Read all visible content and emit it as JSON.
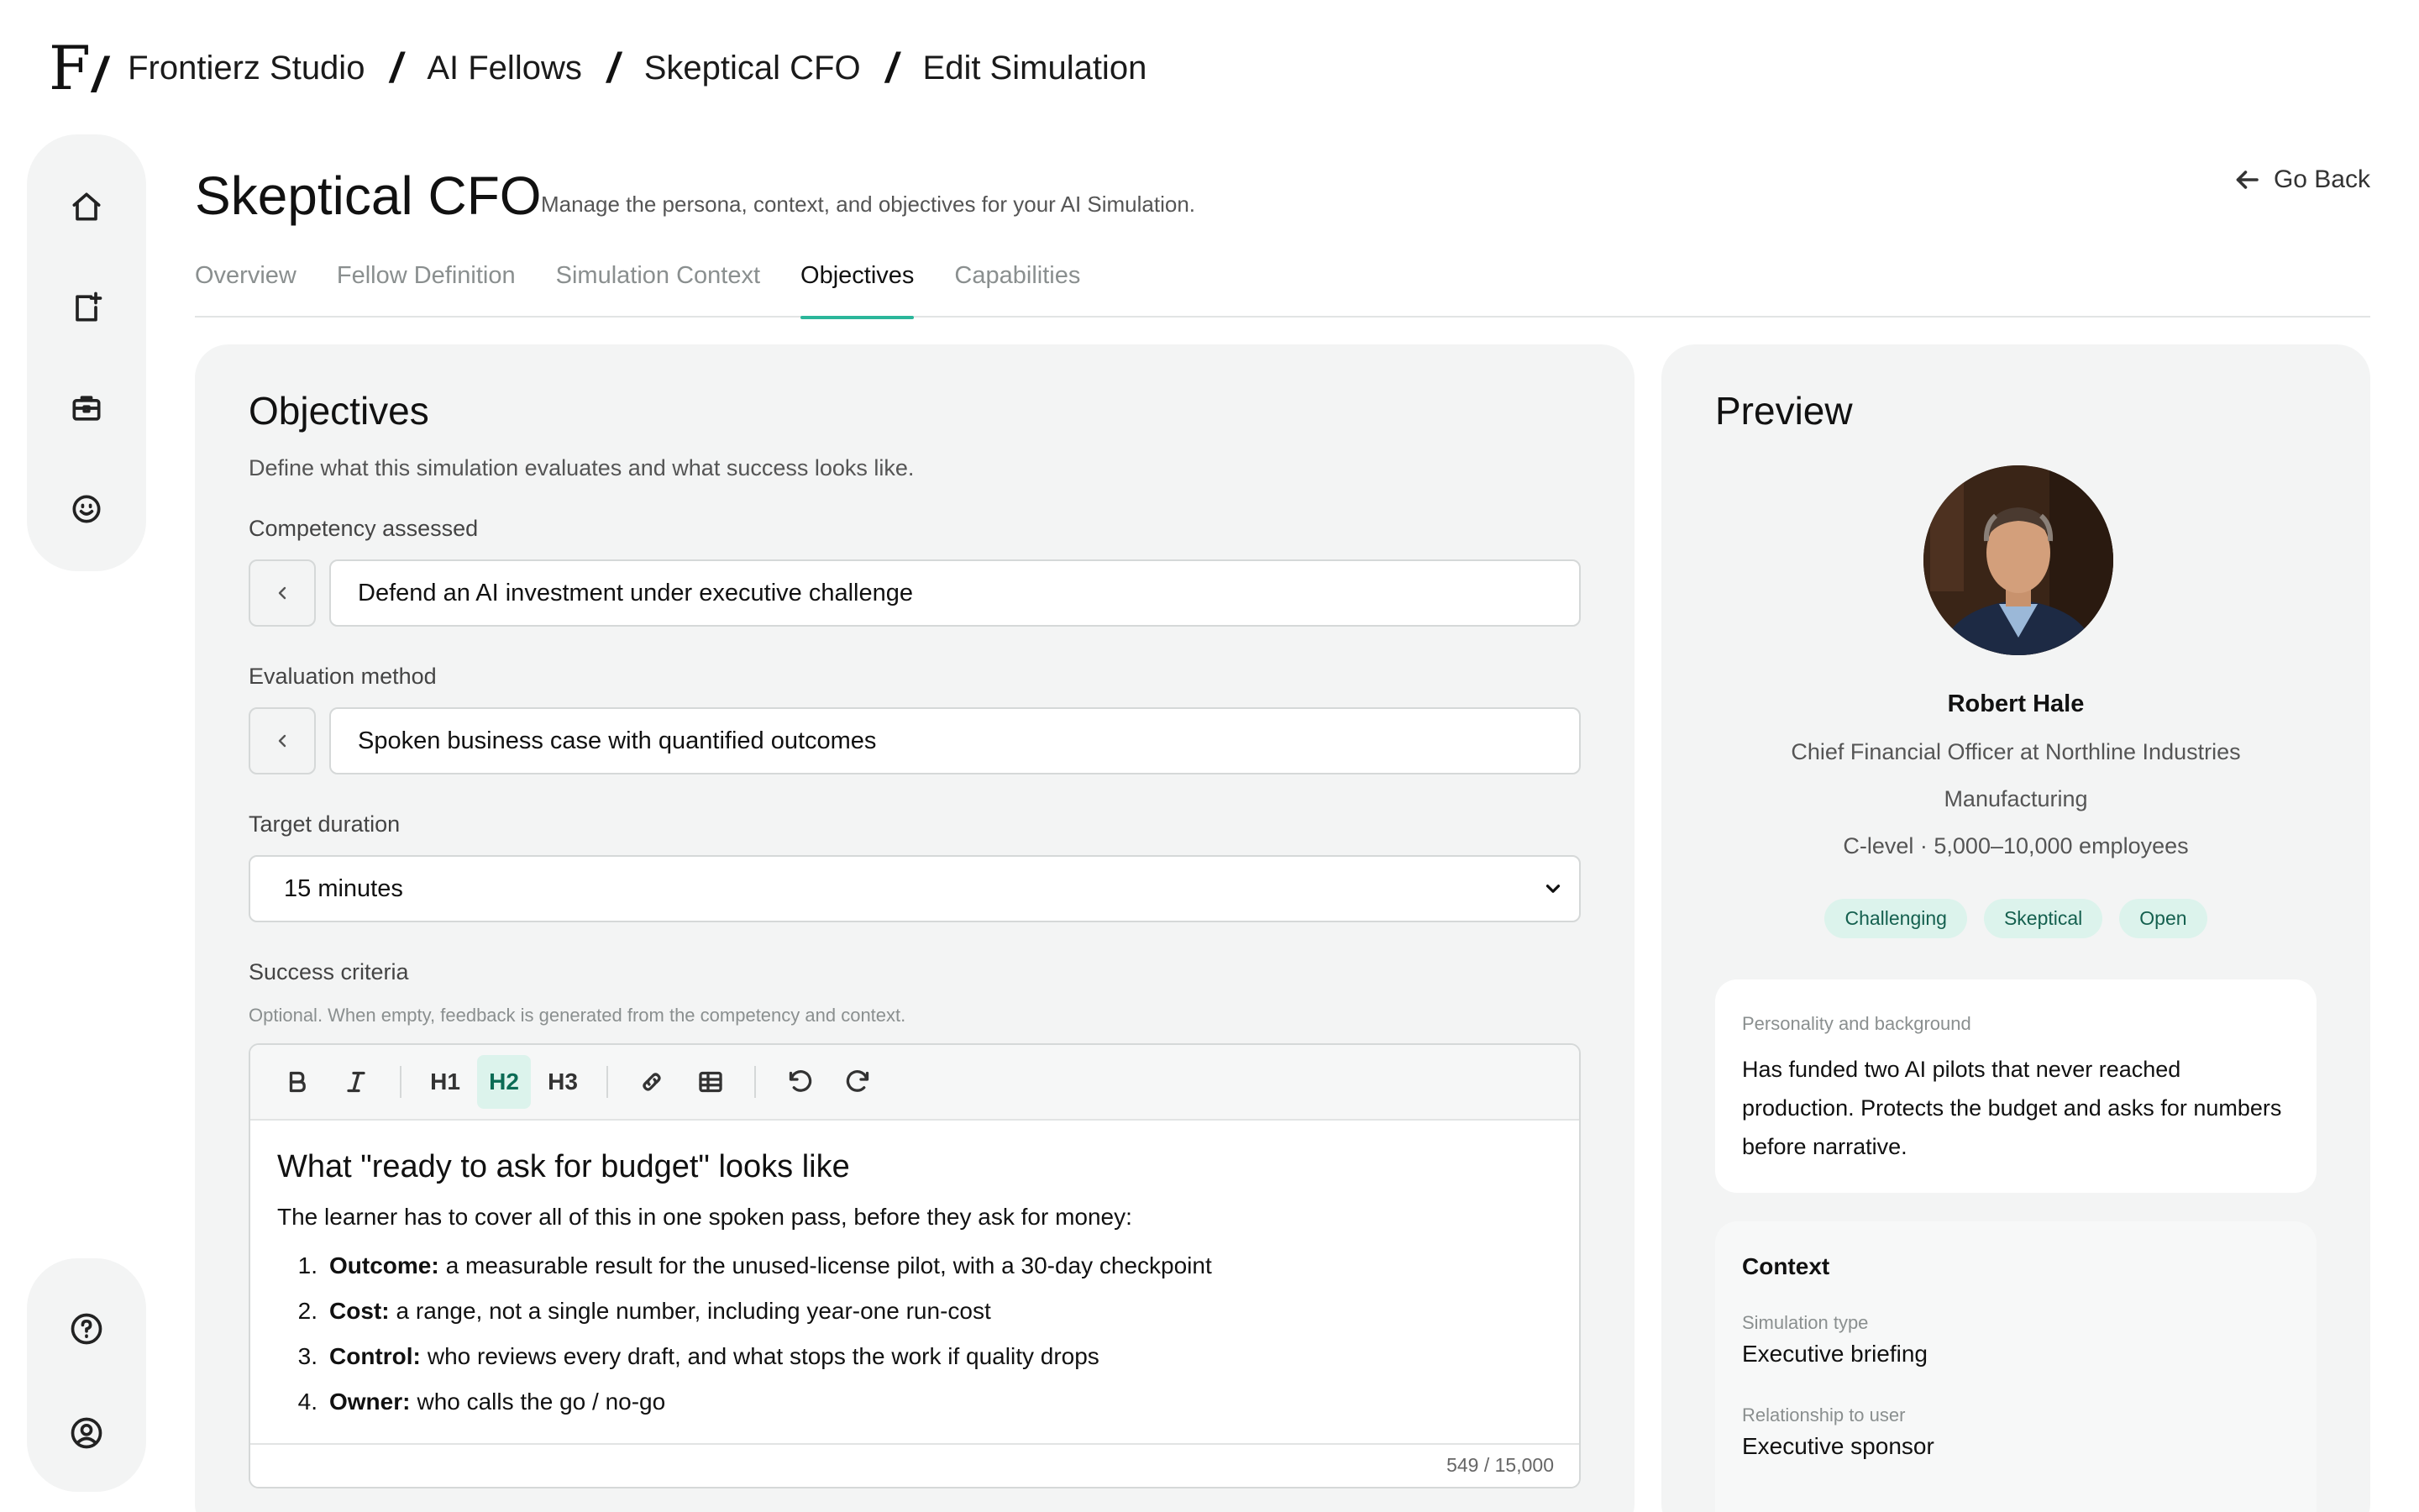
{
  "breadcrumb": {
    "logo": "F",
    "items": [
      "Frontierz Studio",
      "AI Fellows",
      "Skeptical CFO",
      "Edit Simulation"
    ]
  },
  "page": {
    "title": "Skeptical CFO",
    "subtitle": "Manage the persona, context, and objectives for your AI Simulation.",
    "go_back": "Go Back"
  },
  "tabs": [
    "Overview",
    "Fellow Definition",
    "Simulation Context",
    "Objectives",
    "Capabilities"
  ],
  "active_tab": "Objectives",
  "objectives": {
    "title": "Objectives",
    "subtitle": "Define what this simulation evaluates and what success looks like.",
    "competency_label": "Competency assessed",
    "competency_value": "Defend an AI investment under executive challenge",
    "evaluation_label": "Evaluation method",
    "evaluation_value": "Spoken business case with quantified outcomes",
    "duration_label": "Target duration",
    "duration_value": "15 minutes",
    "criteria_label": "Success criteria",
    "criteria_hint": "Optional. When empty, feedback is generated from the competency and context.",
    "toolbar": {
      "h1": "H1",
      "h2": "H2",
      "h3": "H3"
    },
    "editor": {
      "heading": "What \"ready to ask for budget\" looks like",
      "intro": "The learner has to cover all of this in one spoken pass, before they ask for money:",
      "items": [
        {
          "num": "1.",
          "bold": "Outcome:",
          "text": "a measurable result for the unused-license pilot, with a 30-day checkpoint"
        },
        {
          "num": "2.",
          "bold": "Cost:",
          "text": "a range, not a single number, including year-one run-cost"
        },
        {
          "num": "3.",
          "bold": "Control:",
          "text": "who reviews every draft, and what stops the work if quality drops"
        },
        {
          "num": "4.",
          "bold": "Owner:",
          "text": "who calls the go / no-go"
        }
      ],
      "counter": "549 / 15,000"
    }
  },
  "preview": {
    "title": "Preview",
    "name": "Robert Hale",
    "role": "Chief Financial Officer at Northline Industries",
    "industry": "Manufacturing",
    "level": "C-level · 5,000–10,000 employees",
    "tags": [
      "Challenging",
      "Skeptical",
      "Open"
    ],
    "bio_label": "Personality and background",
    "bio_text": "Has funded two AI pilots that never reached production. Protects the budget and asks for numbers before narrative.",
    "context_title": "Context",
    "context": [
      {
        "label": "Simulation type",
        "value": "Executive briefing"
      },
      {
        "label": "Relationship to user",
        "value": "Executive sponsor"
      }
    ]
  },
  "colors": {
    "accent": "#2bb69a",
    "tag_bg": "#dcf3ec",
    "card_bg": "#f3f4f4"
  },
  "icons": {
    "rail_top": [
      "home-icon",
      "new-simulation-icon",
      "briefcase-icon",
      "smile-icon"
    ],
    "rail_bottom": [
      "help-icon",
      "account-icon"
    ]
  }
}
